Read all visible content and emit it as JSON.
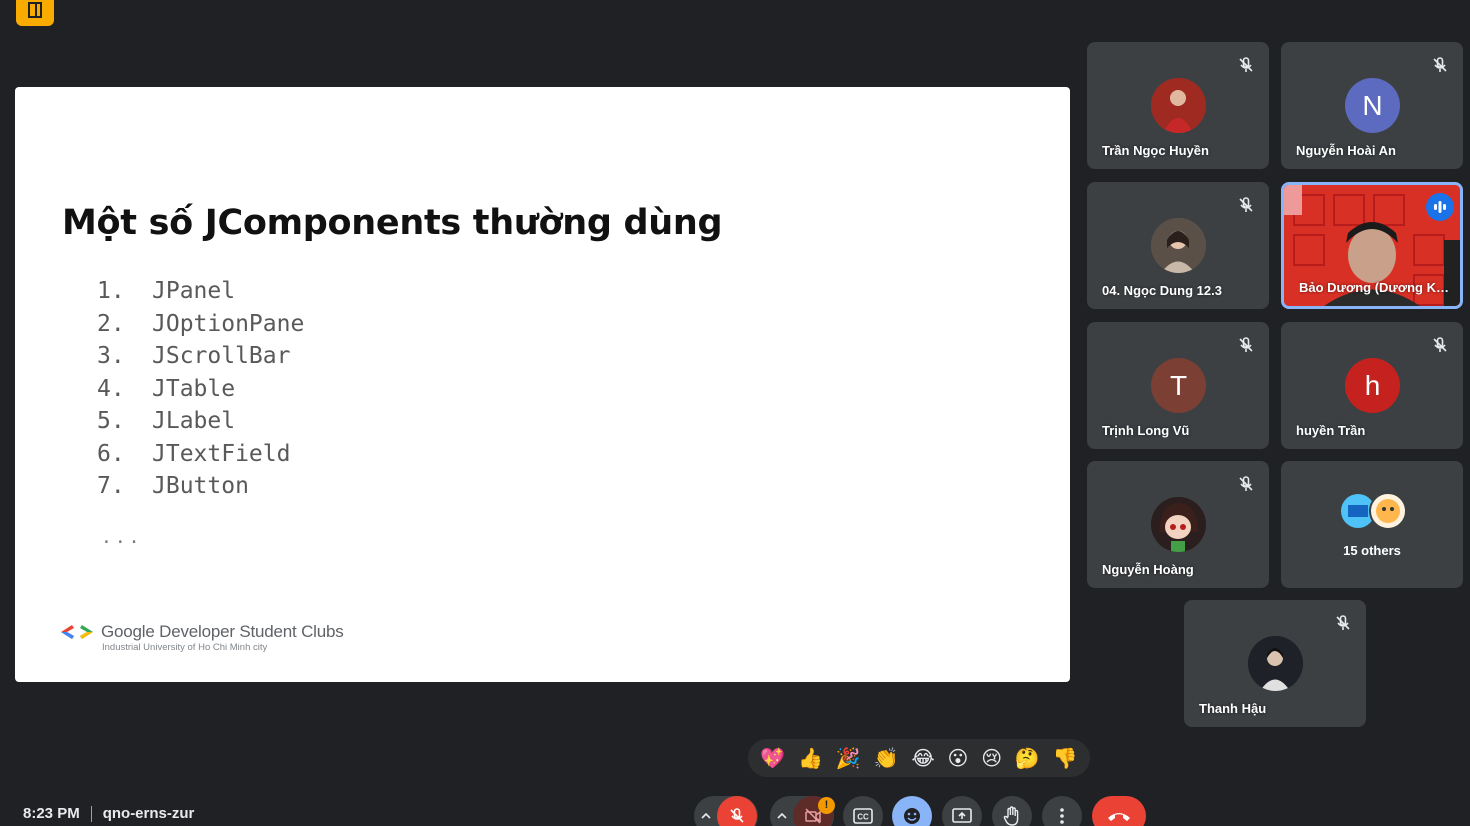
{
  "meeting": {
    "time": "8:23 PM",
    "code": "qno-erns-zur"
  },
  "slide": {
    "title": "Một số JComponents thường dùng",
    "items": [
      {
        "num": "1.",
        "label": "JPanel"
      },
      {
        "num": "2.",
        "label": "JOptionPane"
      },
      {
        "num": "3.",
        "label": "JScrollBar"
      },
      {
        "num": "4.",
        "label": "JTable"
      },
      {
        "num": "5.",
        "label": "JLabel"
      },
      {
        "num": "6.",
        "label": "JTextField"
      },
      {
        "num": "7.",
        "label": "JButton"
      }
    ],
    "ellipsis": "...",
    "org_name": "Google Developer Student Clubs",
    "org_sub": "Industrial University of Ho Chi Minh city"
  },
  "participants": [
    {
      "name": "Trần Ngọc Huyền",
      "initial": "",
      "avatar_color": "#b23a2f"
    },
    {
      "name": "Nguyễn Hoài An",
      "initial": "N",
      "avatar_color": "#5c6bc0"
    },
    {
      "name": "04. Ngọc Dung 12.3",
      "initial": "",
      "avatar_color": "#6d6258"
    },
    {
      "name": "Bảo Dương (Dương Ke...",
      "initial": "",
      "avatar_color": "#d93025"
    },
    {
      "name": "Trịnh Long Vũ",
      "initial": "T",
      "avatar_color": "#7b3f34"
    },
    {
      "name": "huyền Trần",
      "initial": "h",
      "avatar_color": "#c5221f"
    },
    {
      "name": "Nguyễn Hoàng",
      "initial": "",
      "avatar_color": "#3a2a2a"
    },
    {
      "name": "Thanh Hậu",
      "initial": "",
      "avatar_color": "#2b2f35"
    }
  ],
  "others": {
    "label": "15 others"
  },
  "reactions": [
    "💖",
    "👍",
    "🎉",
    "👏",
    "😂",
    "😮",
    "😢",
    "🤔",
    "👎"
  ],
  "controls": {
    "camera_alert": "!"
  },
  "colors": {
    "background": "#202124",
    "tile": "#3c4043",
    "active_border": "#8ab4f8",
    "danger": "#ea4335",
    "accent": "#1a73e8"
  }
}
